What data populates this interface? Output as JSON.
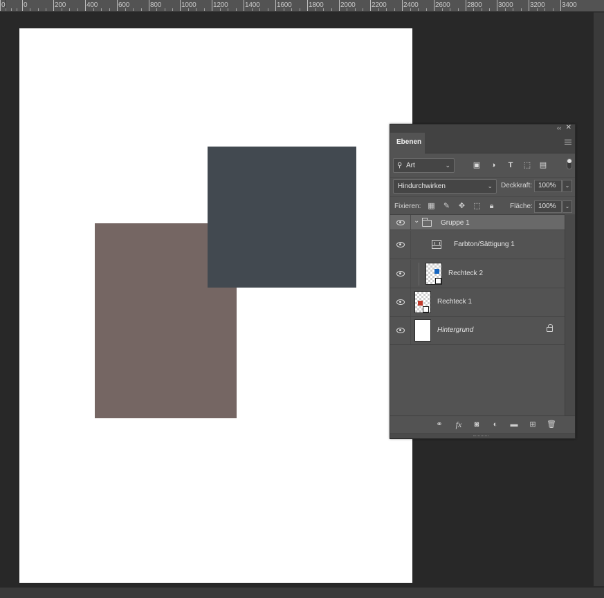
{
  "ruler": {
    "labels": [
      "0",
      "0",
      "200",
      "400",
      "600",
      "800",
      "1000",
      "1200",
      "1400",
      "1600",
      "1800",
      "2000",
      "2200",
      "2400",
      "2600",
      "2800",
      "3000",
      "3200",
      "3400"
    ]
  },
  "panel": {
    "collapse_glyph": "‹‹",
    "close_glyph": "✕",
    "tab": "Ebenen",
    "filter": {
      "value": "Art",
      "icon": "search-icon"
    },
    "blend_mode": "Hindurchwirken",
    "opacity_label": "Deckkraft:",
    "opacity_value": "100%",
    "lock_label": "Fixieren:",
    "fill_label": "Fläche:",
    "fill_value": "100%"
  },
  "layers": [
    {
      "name": "Gruppe 1",
      "kind": "group",
      "selected": true
    },
    {
      "name": "Farbton/Sättigung 1",
      "kind": "adjustment"
    },
    {
      "name": "Rechteck 2",
      "kind": "shape",
      "swatch": "#1565c0"
    },
    {
      "name": "Rechteck 1",
      "kind": "shape",
      "swatch": "#c0392b"
    },
    {
      "name": "Hintergrund",
      "kind": "background",
      "locked": true
    }
  ],
  "canvas": {
    "background": "#ffffff",
    "rect1_color": "#756663",
    "rect2_color": "#424950"
  },
  "footer": {
    "fx_label": "fx"
  }
}
